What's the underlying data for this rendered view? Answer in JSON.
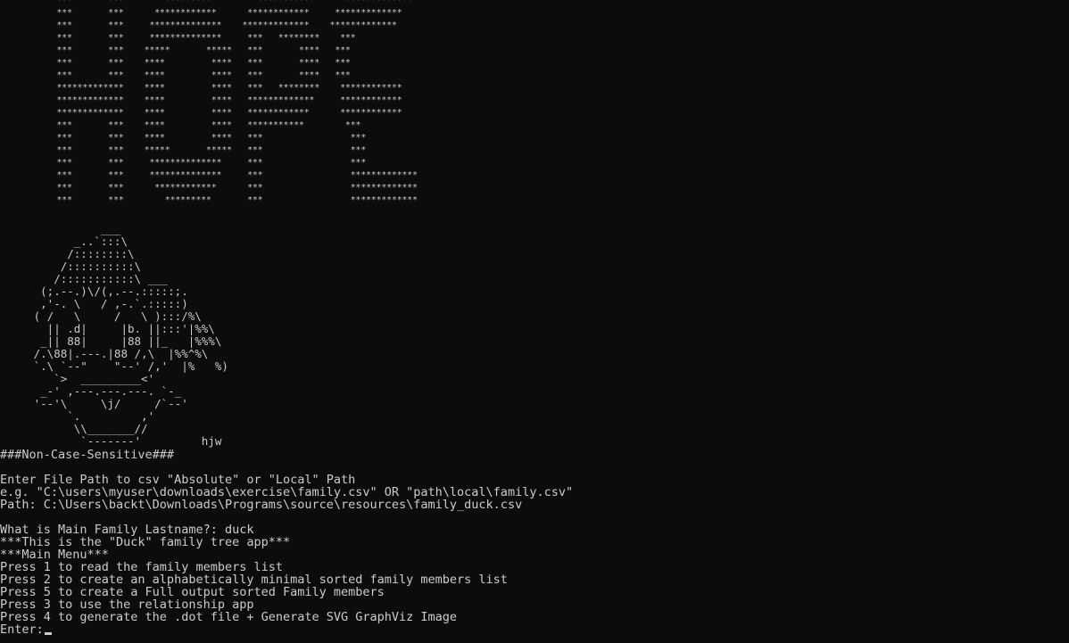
{
  "banner_art": [
    "           ***       ***        *********         ***********      *************",
    "           ***       ***      ************      ************     *************",
    "           ***       ***     **************    *************    *************",
    "           ***       ***     **************     ***   ********    ***",
    "           ***       ***    *****       *****   ***       ****   ***",
    "           ***       ***    ****         ****   ***       ****   ***",
    "           ***       ***    ****         ****   ***       ****   ***",
    "           *************    ****         ****   ***   ********    ************",
    "           *************    ****         ****   *************     ************",
    "           *************    ****         ****   ************      ************",
    "           ***       ***    ****         ****   ***********        ***",
    "           ***       ***    ****         ****   ***                 ***",
    "           ***       ***    *****       *****   ***                 ***",
    "           ***       ***     **************     ***                 ***",
    "           ***       ***     **************     ***                 *************",
    "           ***       ***      ************      ***                 *************",
    "           ***       ***        *********       ***                 *************"
  ],
  "duck_art": [
    "               ___",
    "           _..`:::\\",
    "          /::::::::\\",
    "         /::::::::::\\",
    "        /:::::::::::\\ ___",
    "      (;.--.)\\/(,.--.:::::;.",
    "      ,'-. \\   / ,-.`.:::::)",
    "     ( /   \\     /   \\ ):::/%\\",
    "       || .d|     |b. ||:::'|%%\\",
    "      _|| 88|     |88 ||_   |%%%\\",
    "     /.\\88|.---.|88 /,\\  |%%^%\\",
    "     `.\\ `--\"    \"--' /,'  |%   %)",
    "        `>  _________<'",
    "      _-' ,---.---.---. `-_",
    "     '--'\\     \\j/     /`--'",
    "          `.         ,'",
    "           \\\\_______//",
    "            `-------'         hjw"
  ],
  "session": {
    "non_case_sensitive": "###Non-Case-Sensitive###",
    "blank1": "",
    "enter_path_prompt": "Enter File Path to csv \"Absolute\" or \"Local\" Path",
    "example": "e.g. \"C:\\users\\myuser\\downloads\\exercise\\family.csv\" OR \"path\\local\\family.csv\"",
    "path_entry": "Path: C:\\Users\\backt\\Downloads\\Programs\\source\\resources\\family_duck.csv",
    "blank2": "",
    "lastname_prompt": "What is Main Family Lastname?: duck",
    "app_title": "***This is the \"Duck\" family tree app***",
    "menu_title": "***Main Menu***",
    "menu_items": [
      "Press 1 to read the family members list",
      "Press 2 to create an alphabetically minimal sorted family members list",
      "Press 5 to create a Full output sorted Family members",
      "Press 3 to use the relationship app",
      "Press 4 to generate the .dot file + Generate SVG GraphViz Image"
    ],
    "enter_prompt": "Enter:"
  }
}
